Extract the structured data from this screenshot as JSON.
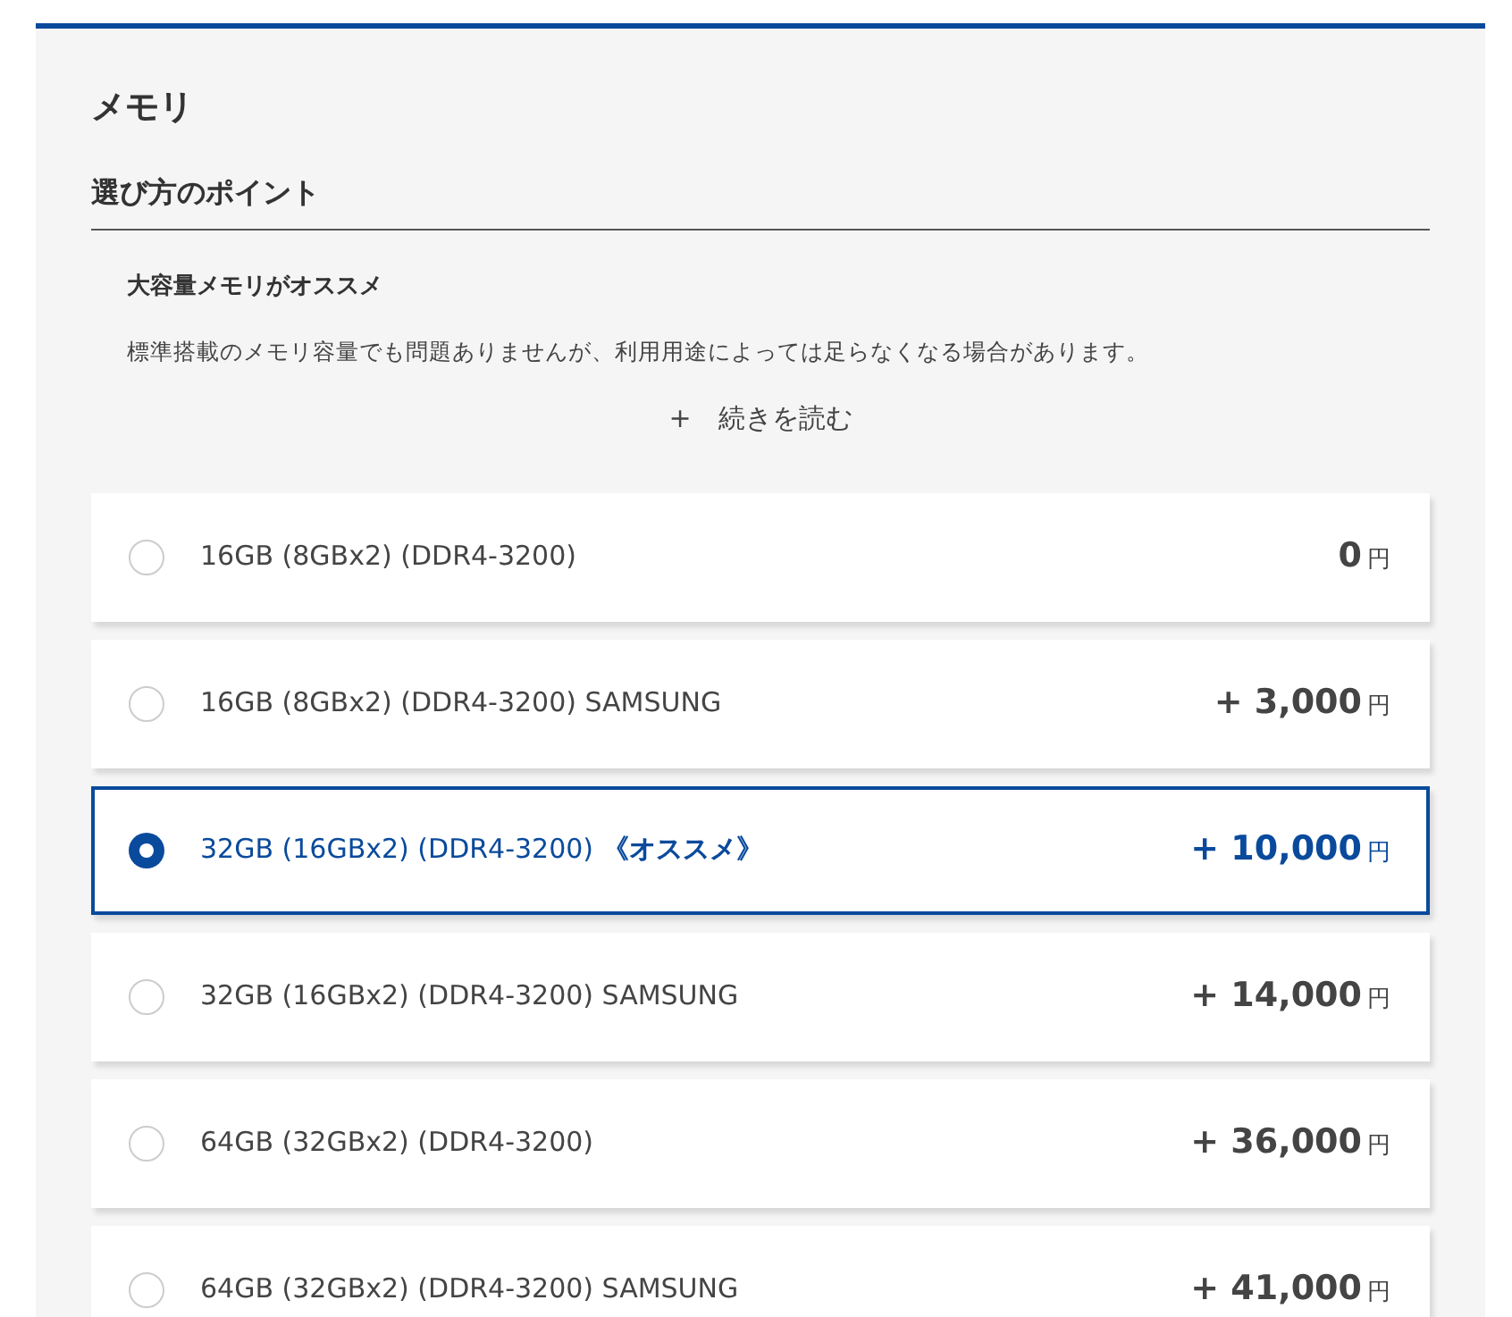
{
  "section_title": "メモリ",
  "guide": {
    "title": "選び方のポイント",
    "subtitle": "大容量メモリがオススメ",
    "paragraphs": [
      "標準搭載のメモリ容量でも問題ありませんが、利用用途によっては足らなくなる場合があります。"
    ],
    "read_more": "+　続きを読む"
  },
  "options": [
    {
      "label": "16GB (8GBx2) (DDR4-3200)",
      "price": "0",
      "unit": "円",
      "selected": false
    },
    {
      "label": "16GB (8GBx2) (DDR4-3200) SAMSUNG",
      "price": "+ 3,000",
      "unit": "円",
      "selected": false
    },
    {
      "label": "32GB (16GBx2) (DDR4-3200) **《オススメ》**",
      "price": "+ 10,000",
      "unit": "円",
      "selected": true
    },
    {
      "label": "32GB (16GBx2) (DDR4-3200) SAMSUNG",
      "price": "+ 14,000",
      "unit": "円",
      "selected": false
    },
    {
      "label": "64GB (32GBx2) (DDR4-3200)",
      "price": "+ 36,000",
      "unit": "円",
      "selected": false
    },
    {
      "label": "64GB (32GBx2) (DDR4-3200) SAMSUNG",
      "price": "+ 41,000",
      "unit": "円",
      "selected": false
    }
  ]
}
